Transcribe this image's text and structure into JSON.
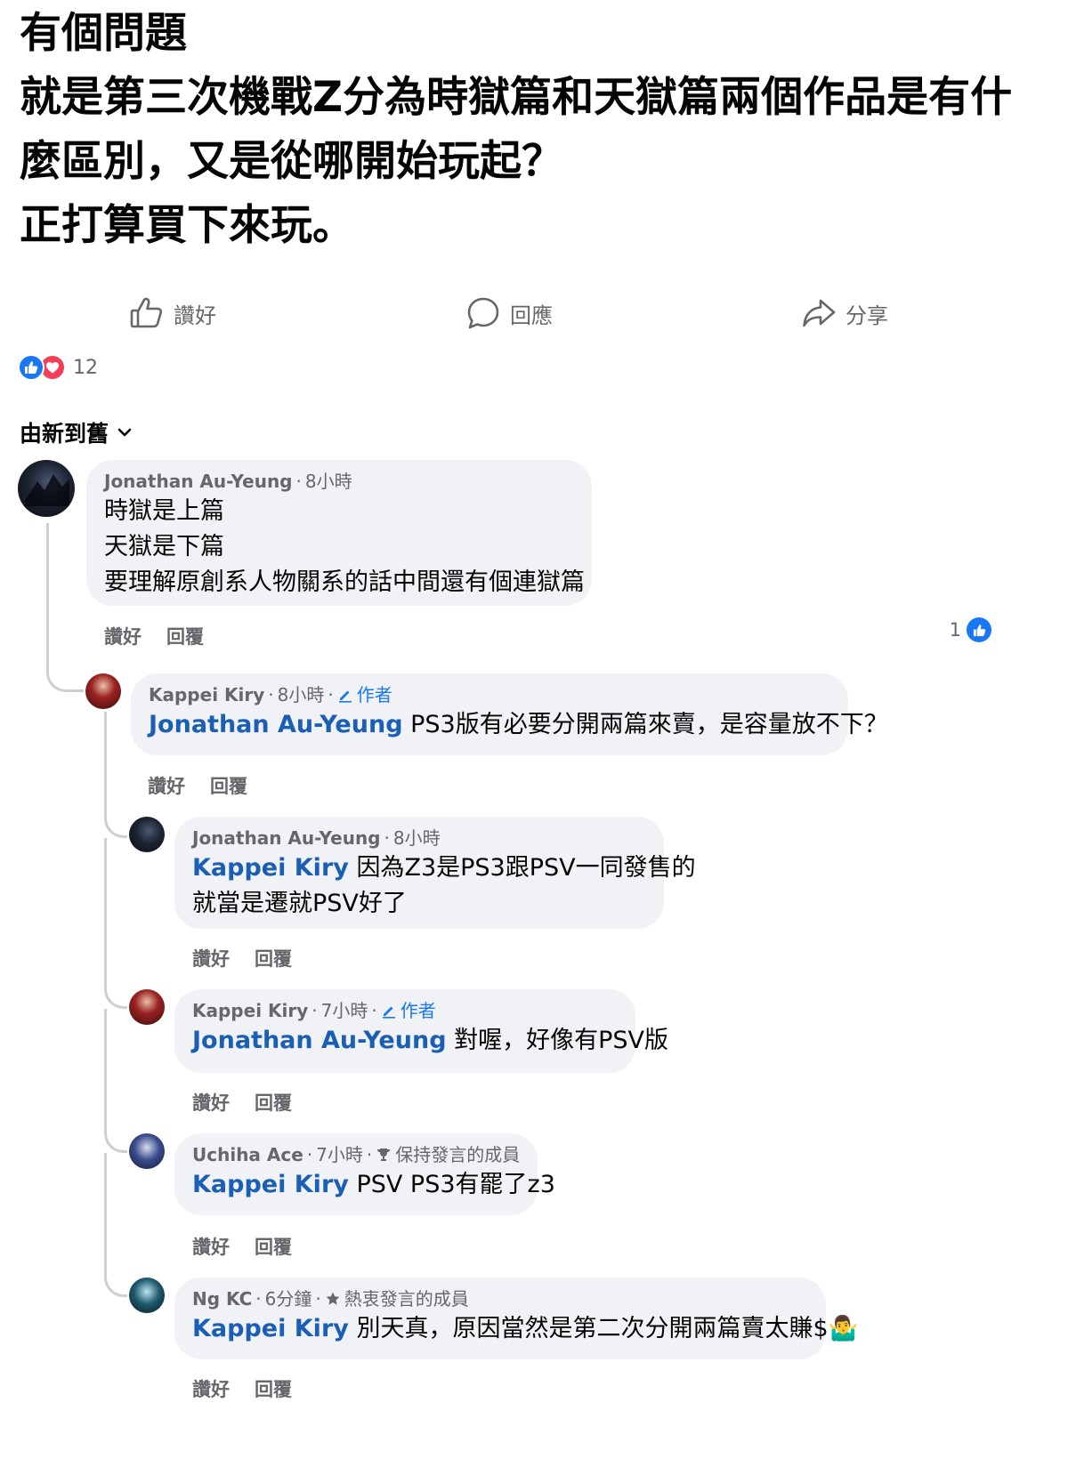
{
  "post": {
    "lines": [
      "有個問題",
      "就是第三次機戰Z分為時獄篇和天獄篇兩個作品是有什",
      "麼區別，又是從哪開始玩起？",
      "正打算買下來玩。"
    ]
  },
  "actions": {
    "like": "讚好",
    "comment": "回應",
    "share": "分享"
  },
  "reactions": {
    "count": "12"
  },
  "sort": {
    "label": "由新到舊"
  },
  "comments": [
    {
      "author": "Jonathan Au-Yeung",
      "time": "8小時",
      "lines": [
        "時獄是上篇",
        "天獄是下篇",
        "要理解原創系人物關系的話中間還有個連獄篇"
      ],
      "like": "讚好",
      "reply": "回覆",
      "like_count": "1"
    },
    {
      "author": "Kappei Kiry",
      "time": "8小時",
      "badge": "作者",
      "mention": "Jonathan Au-Yeung",
      "lines": [
        "PS3版有必要分開兩篇來賣，是容量放不下？"
      ],
      "like": "讚好",
      "reply": "回覆"
    },
    {
      "author": "Jonathan Au-Yeung",
      "time": "8小時",
      "mention": "Kappei Kiry",
      "lines": [
        "因為Z3是PS3跟PSV一同發售的",
        "就當是遷就PSV好了"
      ],
      "like": "讚好",
      "reply": "回覆"
    },
    {
      "author": "Kappei Kiry",
      "time": "7小時",
      "badge": "作者",
      "mention": "Jonathan Au-Yeung",
      "lines": [
        "對喔，好像有PSV版"
      ],
      "like": "讚好",
      "reply": "回覆"
    },
    {
      "author": "Uchiha Ace",
      "time": "7小時",
      "badge": "保持發言的成員",
      "mention": "Kappei Kiry",
      "lines": [
        "PSV PS3有罷了z3"
      ],
      "like": "讚好",
      "reply": "回覆"
    },
    {
      "author": "Ng KC",
      "time": "6分鐘",
      "badge": "熱衷發言的成員",
      "mention": "Kappei Kiry",
      "lines": [
        "別天真，原因當然是第二次分開兩篇賣太賺$🤷‍♂️"
      ],
      "like": "讚好",
      "reply": "回覆"
    }
  ],
  "colors": {
    "accent": "#1877f2",
    "mention": "#1a5fb4",
    "bubble": "#f0f2f5",
    "muted": "#65676b"
  }
}
